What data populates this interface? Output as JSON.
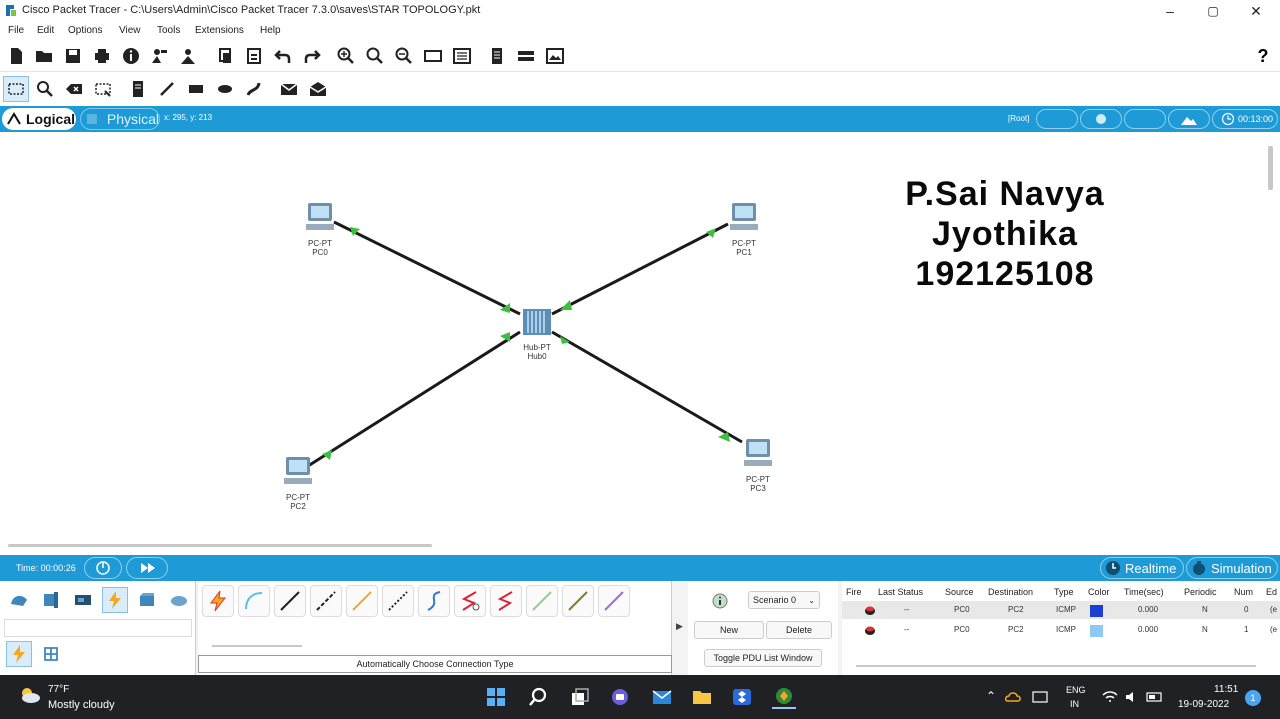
{
  "window": {
    "title": "Cisco Packet Tracer - C:\\Users\\Admin\\Cisco Packet Tracer 7.3.0\\saves\\STAR TOPOLOGY.pkt",
    "minimize": "–",
    "maximize": "▢",
    "close": "✕"
  },
  "menu": [
    "File",
    "Edit",
    "Options",
    "View",
    "Tools",
    "Extensions",
    "Help"
  ],
  "help_icon": "?",
  "tabs": {
    "logical": "Logical",
    "physical": "Physical",
    "coords": "x: 295, y: 213",
    "root": "[Root]",
    "clock": "00:13:00"
  },
  "devices": [
    {
      "type": "PC-PT",
      "name": "PC0"
    },
    {
      "type": "PC-PT",
      "name": "PC1"
    },
    {
      "type": "Hub-PT",
      "name": "Hub0"
    },
    {
      "type": "PC-PT",
      "name": "PC2"
    },
    {
      "type": "PC-PT",
      "name": "PC3"
    }
  ],
  "overlay_text": {
    "line1": "P.Sai Navya",
    "line2": "Jyothika",
    "line3": "192125108"
  },
  "timebar": {
    "time": "Time: 00:00:26",
    "realtime": "Realtime",
    "simulation": "Simulation"
  },
  "connections": {
    "status": "Automatically Choose Connection Type"
  },
  "scenario": {
    "select": "Scenario 0",
    "new": "New",
    "delete": "Delete",
    "toggle": "Toggle PDU List Window"
  },
  "pdu_table": {
    "headers": [
      "Fire",
      "Last Status",
      "Source",
      "Destination",
      "Type",
      "Color",
      "Time(sec)",
      "Periodic",
      "Num",
      "Ed"
    ],
    "rows": [
      {
        "last_status": "--",
        "source": "PC0",
        "destination": "PC2",
        "type": "ICMP",
        "color": "#1a3fd1",
        "time": "0.000",
        "periodic": "N",
        "num": "0",
        "edit": "(e"
      },
      {
        "last_status": "--",
        "source": "PC0",
        "destination": "PC2",
        "type": "ICMP",
        "color": "#8ec9f2",
        "time": "0.000",
        "periodic": "N",
        "num": "1",
        "edit": "(e"
      }
    ]
  },
  "taskbar": {
    "temp": "77°F",
    "weather": "Mostly cloudy",
    "lang1": "ENG",
    "lang2": "IN",
    "time": "11:51",
    "date": "19-09-2022",
    "notif": "1"
  },
  "colors": {
    "accent": "#1e9bd7",
    "link_dot": "#3fbf3f",
    "taskbar": "#202124"
  }
}
